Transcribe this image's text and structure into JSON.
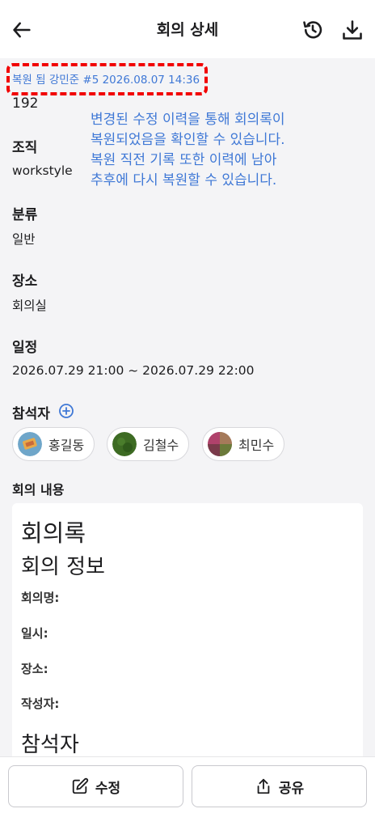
{
  "header": {
    "title": "회의 상세",
    "back_icon": "arrow-left-icon",
    "history_icon": "history-icon",
    "download_icon": "download-icon"
  },
  "restore_badge": "복원 됨 강민준 #5 2026.08.07 14:36",
  "annotation": {
    "lines": [
      "변경된 수정 이력을 통해 회의록이",
      "복원되었음을 확인할 수 있습니다.",
      "복원 직전 기록 또한 이력에 남아",
      "추후에 다시 복원할 수 있습니다."
    ],
    "color": "#3f78d6"
  },
  "meeting": {
    "id_value": "192",
    "org_label": "조직",
    "org_value": "workstyle",
    "category_label": "분류",
    "category_value": "일반",
    "place_label": "장소",
    "place_value": "회의실",
    "schedule_label": "일정",
    "schedule_value": "2026.07.29 21:00 ~ 2026.07.29 22:00",
    "attendees_label": "참석자",
    "attendees": [
      {
        "name": "홍길동"
      },
      {
        "name": "김철수"
      },
      {
        "name": "최민수"
      }
    ],
    "content_label": "회의 내용"
  },
  "content": {
    "h1": "회의록",
    "h2": "회의 정보",
    "fields": [
      "회의명:",
      "일시:",
      "장소:",
      "작성자:"
    ],
    "h2b": "참석자"
  },
  "actions": {
    "edit_label": "수정",
    "share_label": "공유"
  },
  "colors": {
    "accent": "#3f78d6",
    "highlight_border": "#f10000"
  }
}
